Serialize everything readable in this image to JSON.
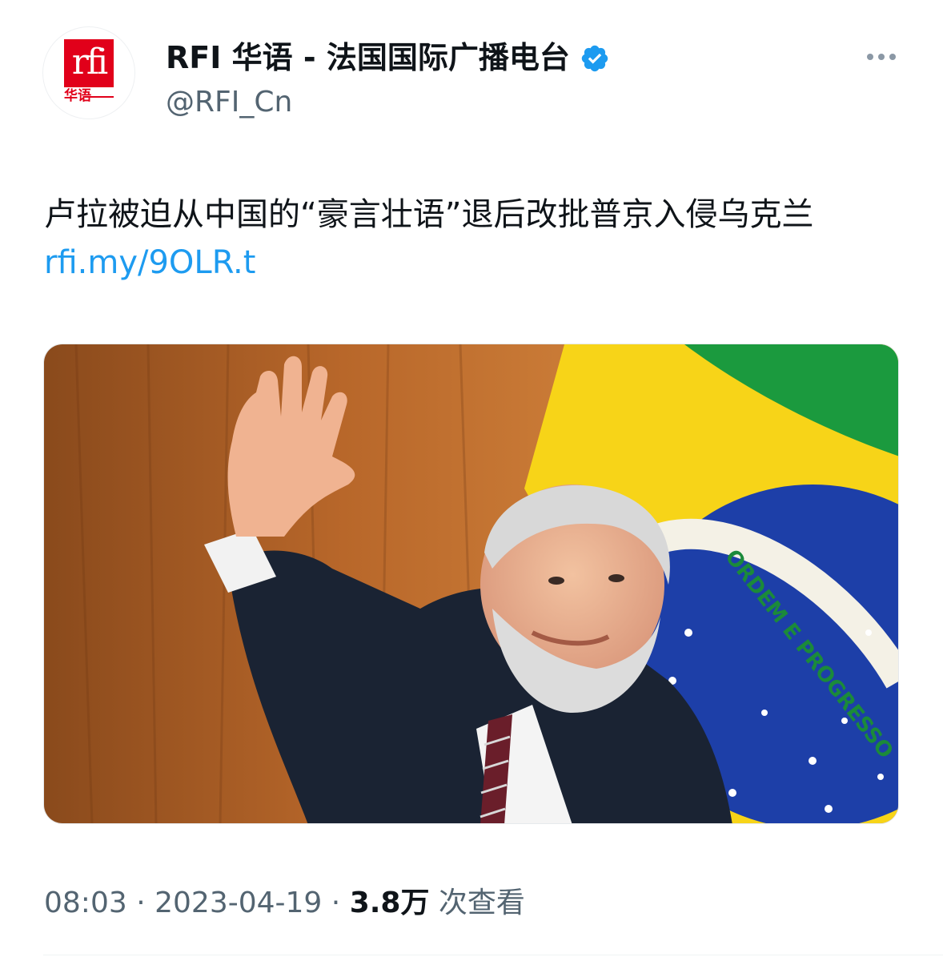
{
  "tweet": {
    "author": {
      "display_name": "RFI 华语 - 法国国际广播电台",
      "handle": "@RFI_Cn",
      "verified": true,
      "avatar_logo_text": "rfi",
      "avatar_logo_subtext": "华语",
      "avatar_brand_color": "#e1001a",
      "verified_badge_color": "#1d9bf0"
    },
    "more_icon": "more-horizontal-icon",
    "text": "卢拉被迫从中国的“豪言壮语”退后改批普京入侵乌克兰",
    "link_text": "rfi.my/9OLR.t",
    "link_color": "#1d9bf0",
    "media": {
      "flag_banner_text": "ORDEM E PROGRESSO"
    },
    "meta": {
      "time": "08:03",
      "separator": "·",
      "date": "2023-04-19",
      "views_count": "3.8万",
      "views_label": "次查看"
    }
  }
}
